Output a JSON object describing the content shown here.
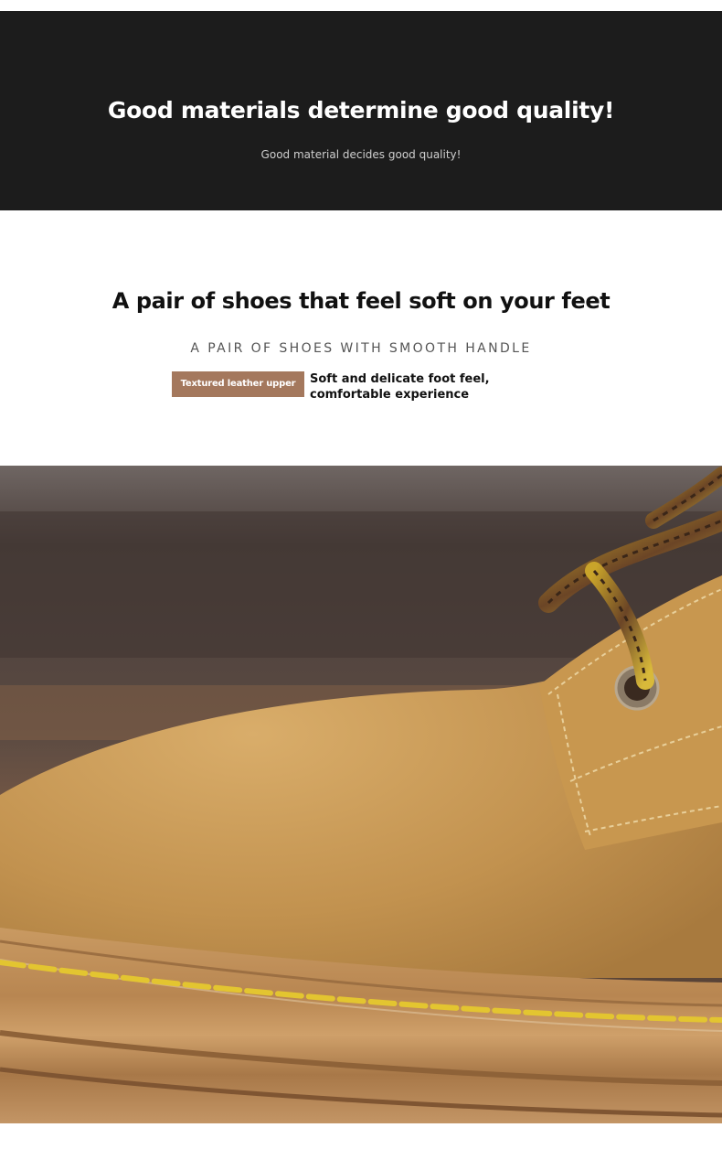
{
  "banner": {
    "title": "Good materials determine good quality!",
    "subtitle": "Good material decides good quality!"
  },
  "section": {
    "title": "A pair of shoes that feel soft on your feet",
    "subtitle": "A PAIR OF SHOES WITH SMOOTH HANDLE",
    "tag_label": "Textured leather upper",
    "description_line1": "Soft and delicate foot feel,",
    "description_line2": "comfortable experience"
  },
  "photo": {
    "subject": "close-up of tan nubuck leather boot toe with yellow stitched welt and yellow-brown laces",
    "colors": {
      "leather": "#c79a55",
      "stitch": "#e3c530",
      "lace_dark": "#5a3b24",
      "background": "#4a3d38"
    }
  }
}
